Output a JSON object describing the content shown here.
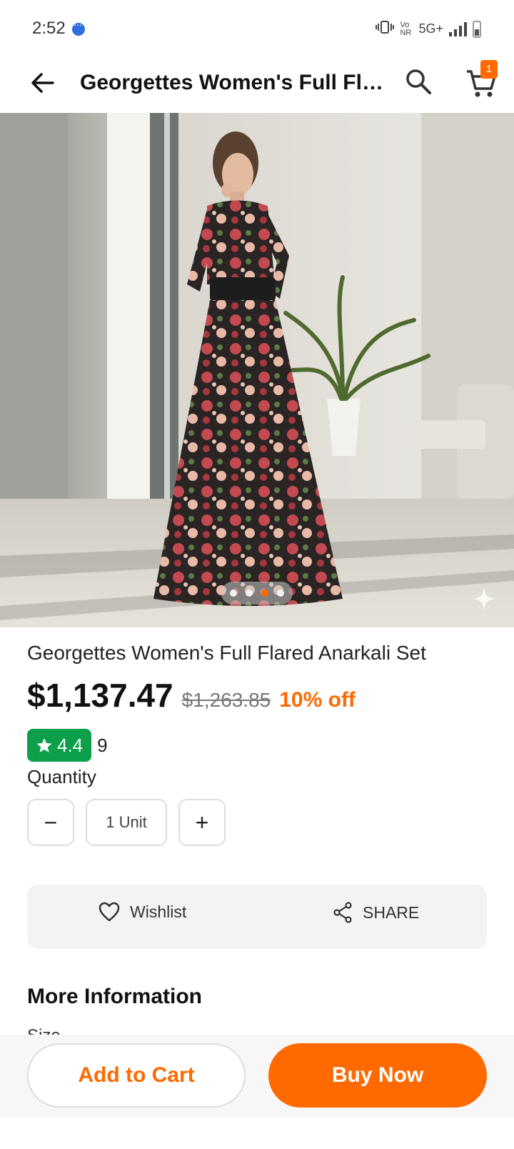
{
  "status_bar": {
    "time": "2:52",
    "network": "5G+",
    "volte": "Vo NR"
  },
  "app_bar": {
    "title": "Georgettes Women's Full Flared Anarkali Set",
    "cart_count": "1"
  },
  "gallery": {
    "image_count": 4,
    "active_index": 2
  },
  "product": {
    "title": "Georgettes Women's Full Flared Anarkali Set",
    "price": "$1,137.47",
    "mrp": "$1,263.85",
    "discount": "10% off",
    "rating": "4.4",
    "rating_count": "9"
  },
  "quantity": {
    "label": "Quantity",
    "value": "1 Unit",
    "minus": "−",
    "plus": "+"
  },
  "actions": {
    "wishlist": "Wishlist",
    "share": "SHARE"
  },
  "more_info": {
    "title": "More Information",
    "first_row_label": "Size"
  },
  "bottom": {
    "add_to_cart": "Add to Cart",
    "buy_now": "Buy Now"
  },
  "colors": {
    "accent": "#ff6a00",
    "rating_green": "#0ca04a"
  }
}
